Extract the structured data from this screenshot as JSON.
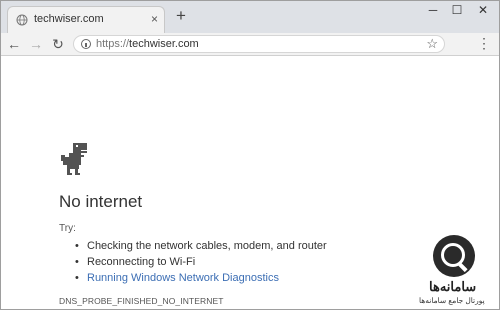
{
  "tab": {
    "title": "techwiser.com",
    "close_glyph": "×",
    "favicon": "globe-icon"
  },
  "tabstrip": {
    "new_tab_glyph": "+",
    "window_controls": {
      "minimize": "─",
      "maximize": "☐",
      "close": "✕"
    }
  },
  "toolbar": {
    "back_glyph": "←",
    "forward_glyph": "→",
    "reload_glyph": "↻",
    "url_scheme": "https://",
    "url_host": "techwiser.com",
    "star_glyph": "☆",
    "menu_glyph": "⋮"
  },
  "page": {
    "heading": "No internet",
    "try_label": "Try:",
    "suggestions": [
      "Checking the network cables, modem, and router",
      "Reconnecting to Wi-Fi",
      "Running Windows Network Diagnostics"
    ],
    "error_code": "DNS_PROBE_FINISHED_NO_INTERNET"
  },
  "watermark": {
    "title": "سامانه‌ها",
    "subtitle": "پورتال جامع سامانه‌ها"
  },
  "colors": {
    "link": "#3c6eb4",
    "tabstrip": "#dee1e6",
    "toolbar": "#f2f2f2"
  }
}
